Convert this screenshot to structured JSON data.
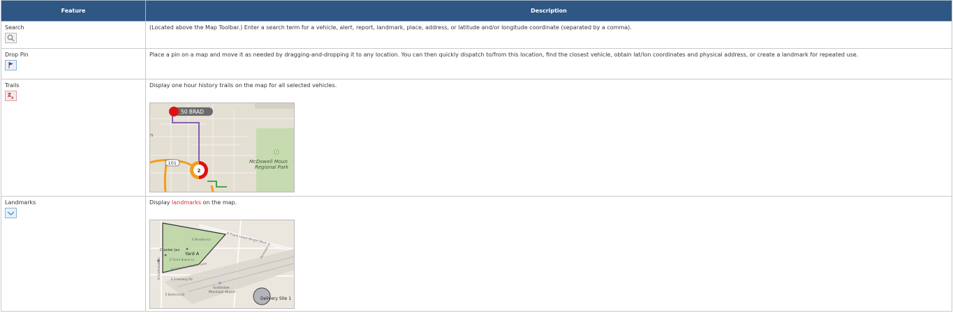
{
  "headers": {
    "feature": "Feature",
    "description": "Description"
  },
  "rows": [
    {
      "feature": "Search",
      "icon": "search-icon",
      "description": "(Located above the Map Toolbar.) Enter a search term for a vehicle, alert, report, landmark, place, address, or latitude and/or longitude coordinate (separated by a comma)."
    },
    {
      "feature": "Drop Pin",
      "icon": "flag-pin-icon",
      "description": "Place a pin on a map and move it as needed by dragging-and-dropping it to any location. You can then quickly dispatch to/from this location, find the closest vehicle, obtain lat/lon coordinates and physical address, or create a landmark for repeated use."
    },
    {
      "feature": "Trails",
      "icon": "trails-icon",
      "description": "Display one hour history trails on the map for all selected vehicles.",
      "map": {
        "vehicle_label": "50 BRAD",
        "route_shield": "101",
        "cluster_count": "2",
        "park_line1": "McDowell Moun",
        "park_line2": "Regional Park",
        "edge_text": "n"
      }
    },
    {
      "feature": "Landmarks",
      "icon": "landmark-icon",
      "description_before": "Display ",
      "description_link": "landmarks",
      "description_after": " on the map.",
      "map": {
        "poly_label": "Yard A",
        "company_label": "Cracker Jax",
        "circle_label": "Delivery Site 1",
        "airport_line1": "Scottsdale",
        "airport_line2": "Municipal Airport",
        "road1": "E Frank Lloyd Wright Blvd",
        "road2": "E Paradise Ln",
        "road3": "E Tierra Buena Ln",
        "road4": "N Greenway Hayden Loop",
        "road5": "E Greenway Rd",
        "road6": "E Butherus Dr",
        "road7": "N Scottsdale Rd",
        "road8": "Perimeter Dr"
      }
    }
  ],
  "colors": {
    "header_bg": "#2e5783",
    "link": "#cc3333",
    "pin": "#e01010",
    "trail": "#7a4fb0",
    "highway": "#f39c1e",
    "park": "#c6dbb0"
  }
}
